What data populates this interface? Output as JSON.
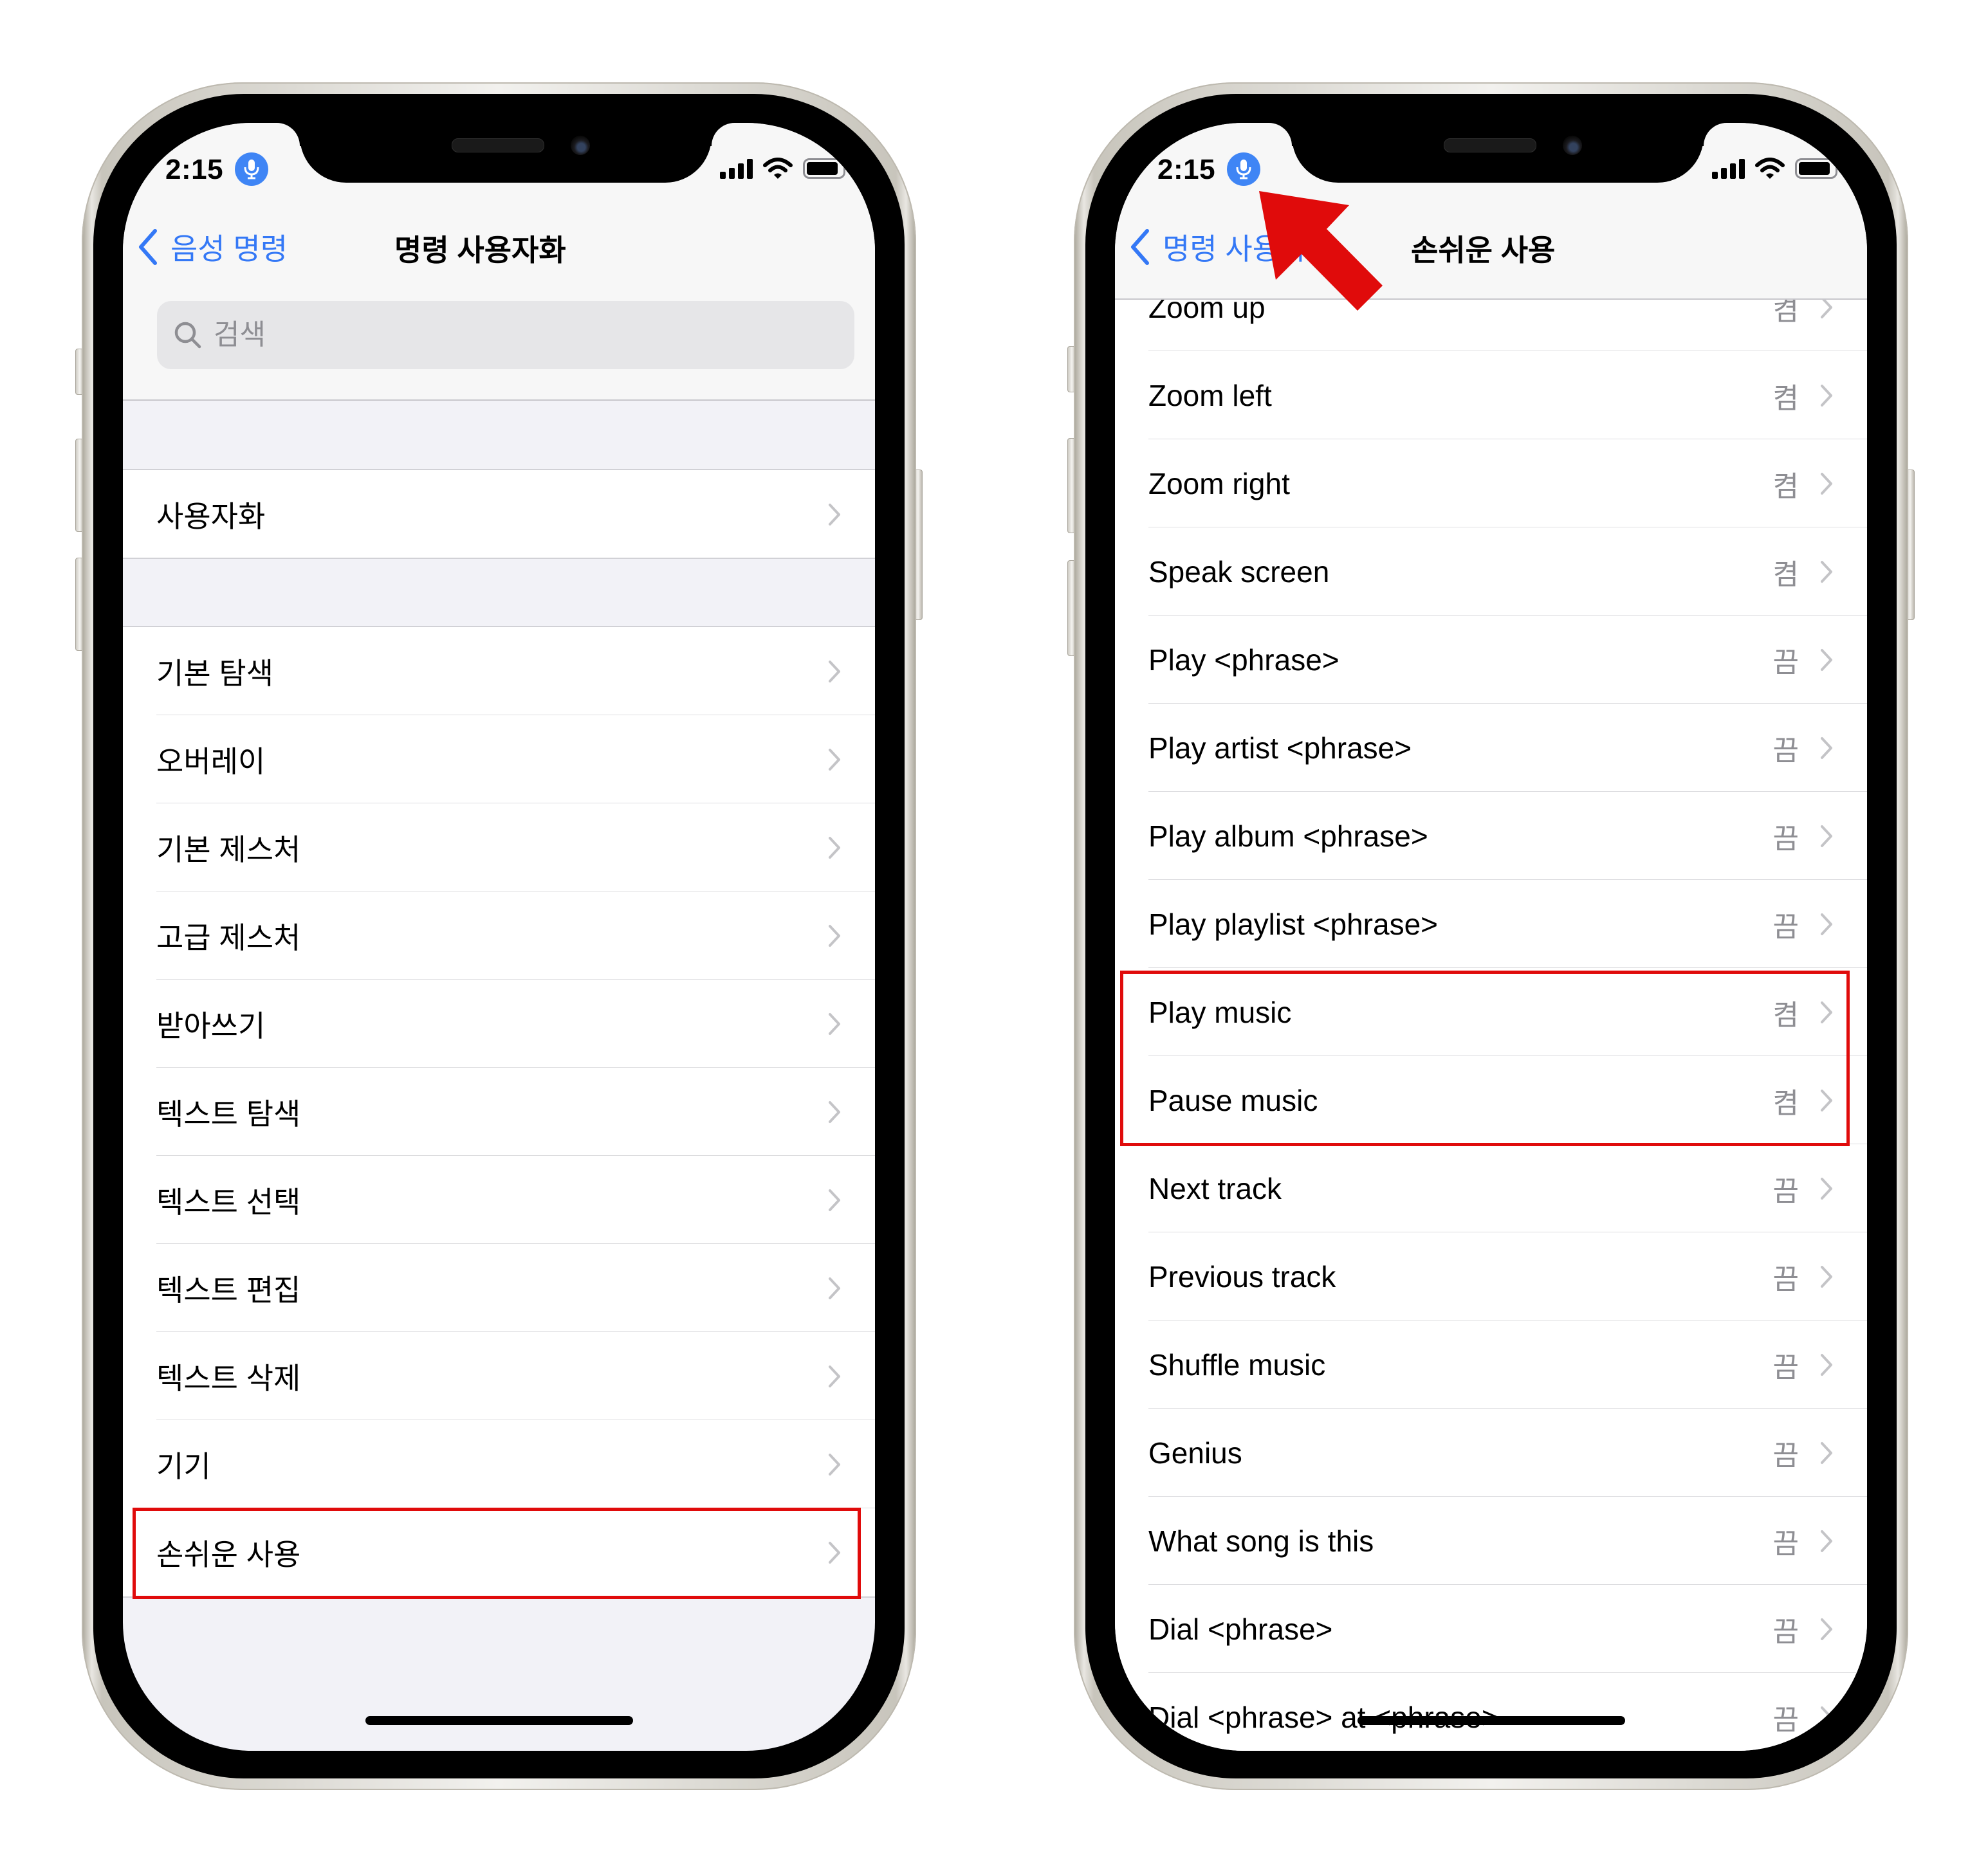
{
  "colors": {
    "accent": "#3478f6",
    "mic_badge": "#3f85f5",
    "highlight": "#e00b0b",
    "secondary_text": "#8e8e93",
    "grouped_background": "#f2f2f7"
  },
  "left_phone": {
    "status_bar": {
      "time": "2:15",
      "mic_icon": "microphone-icon",
      "signal_icon": "cellular-signal-icon",
      "wifi_icon": "wifi-icon",
      "battery_icon": "battery-icon"
    },
    "nav": {
      "back_label": "음성 명령",
      "title": "명령 사용자화"
    },
    "search": {
      "placeholder": "검색",
      "value": ""
    },
    "sections": [
      {
        "items": [
          {
            "label": "사용자화"
          }
        ]
      },
      {
        "items": [
          {
            "label": "기본 탐색"
          },
          {
            "label": "오버레이"
          },
          {
            "label": "기본 제스처"
          },
          {
            "label": "고급 제스처"
          },
          {
            "label": "받아쓰기"
          },
          {
            "label": "텍스트 탐색"
          },
          {
            "label": "텍스트 선택"
          },
          {
            "label": "텍스트 편집"
          },
          {
            "label": "텍스트 삭제"
          },
          {
            "label": "기기"
          },
          {
            "label": "손쉬운 사용",
            "highlighted": true
          }
        ]
      }
    ]
  },
  "right_phone": {
    "status_bar": {
      "time": "2:15",
      "mic_icon": "microphone-icon",
      "signal_icon": "cellular-signal-icon",
      "wifi_icon": "wifi-icon",
      "battery_icon": "battery-icon"
    },
    "nav": {
      "back_label": "명령 사용자화",
      "title": "손쉬운 사용"
    },
    "commands": [
      {
        "label": "Zoom up",
        "value": "켬"
      },
      {
        "label": "Zoom left",
        "value": "켬"
      },
      {
        "label": "Zoom right",
        "value": "켬"
      },
      {
        "label": "Speak screen",
        "value": "켬"
      },
      {
        "label": "Play <phrase>",
        "value": "끔"
      },
      {
        "label": "Play artist <phrase>",
        "value": "끔"
      },
      {
        "label": "Play album <phrase>",
        "value": "끔"
      },
      {
        "label": "Play playlist <phrase>",
        "value": "끔"
      },
      {
        "label": "Play music",
        "value": "켬",
        "highlighted": true
      },
      {
        "label": "Pause music",
        "value": "켬",
        "highlighted": true
      },
      {
        "label": "Next track",
        "value": "끔"
      },
      {
        "label": "Previous track",
        "value": "끔"
      },
      {
        "label": "Shuffle music",
        "value": "끔"
      },
      {
        "label": "Genius",
        "value": "끔"
      },
      {
        "label": "What song is this",
        "value": "끔"
      },
      {
        "label": "Dial <phrase>",
        "value": "끔"
      },
      {
        "label": "Dial <phrase> at <phrase>",
        "value": "끔"
      }
    ]
  },
  "annotations": {
    "arrow": {
      "points_to": "microphone-icon",
      "color": "#e00b0b"
    },
    "highlight_boxes": [
      "left-row-손쉬운 사용",
      "right-rows-Play music/Pause music"
    ]
  }
}
